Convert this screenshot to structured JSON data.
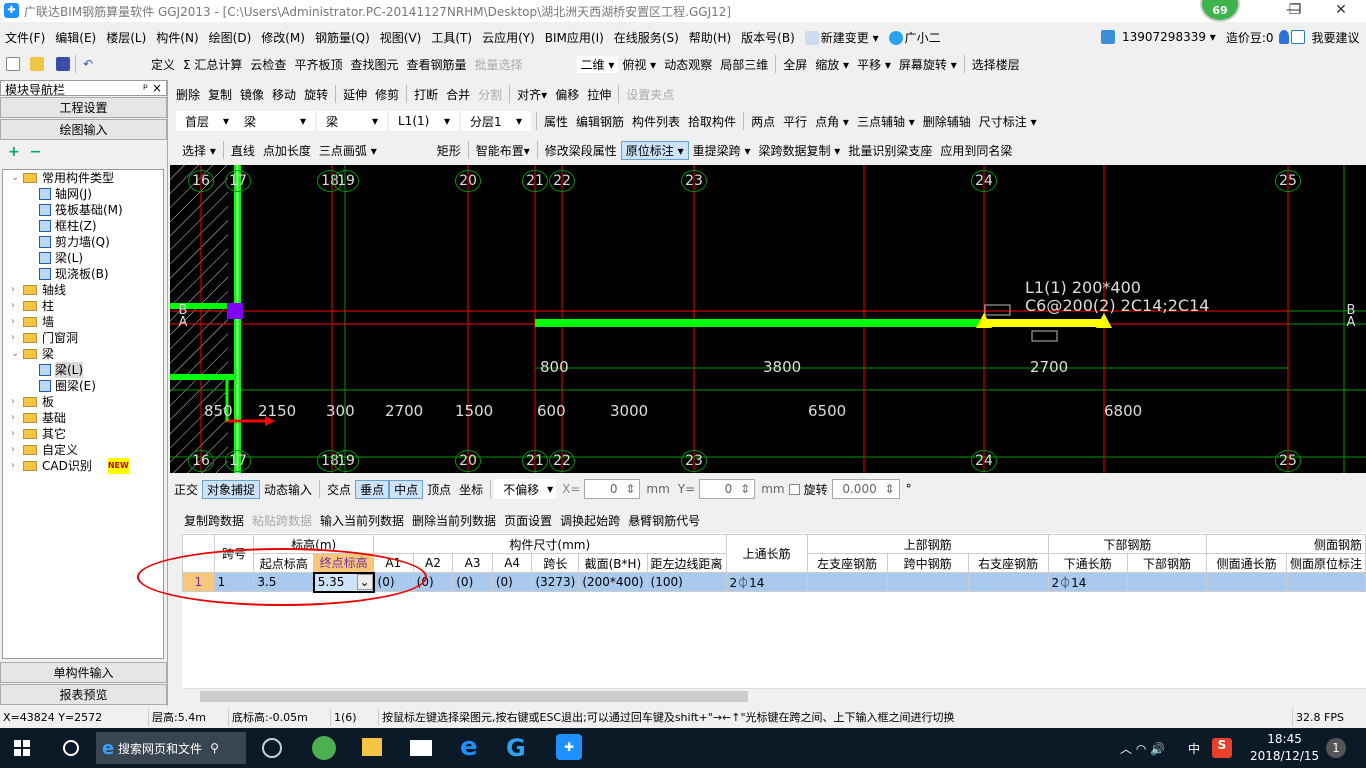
{
  "window": {
    "title": "广联达BIM钢筋算量软件 GGJ2013 - [C:\\Users\\Administrator.PC-20141127NRHM\\Desktop\\湖北洲天西湖桥安置区工程.GGJ12]",
    "badge": "69",
    "min": "—",
    "max": "❐",
    "close": "✕"
  },
  "menu": [
    "文件(F)",
    "编辑(E)",
    "楼层(L)",
    "构件(N)",
    "绘图(D)",
    "修改(M)",
    "钢筋量(Q)",
    "视图(V)",
    "工具(T)",
    "云应用(Y)",
    "BIM应用(I)",
    "在线服务(S)",
    "帮助(H)",
    "版本号(B)",
    "新建变更 ▾",
    "广小二"
  ],
  "account": {
    "phone": "13907298339 ▾",
    "beans": "造价豆:0",
    "suggest": "我要建议"
  },
  "toolbar1": {
    "items": [
      "定义",
      "Σ 汇总计算",
      "云检查",
      "平齐板顶",
      "查找图元",
      "查看钢筋量",
      "批量选择"
    ],
    "view": [
      "二维 ▾",
      "俯视 ▾",
      "动态观察",
      "局部三维",
      "全屏",
      "缩放 ▾",
      "平移 ▾",
      "屏幕旋转 ▾",
      "选择楼层"
    ]
  },
  "toolbar2": [
    "删除",
    "复制",
    "镜像",
    "移动",
    "旋转",
    "延伸",
    "修剪",
    "打断",
    "合并",
    "分割",
    "对齐▾",
    "偏移",
    "拉伸",
    "设置夹点"
  ],
  "toolbar3": {
    "combos": [
      "首层",
      "梁",
      "梁",
      "L1(1)",
      "分层1"
    ],
    "items": [
      "属性",
      "编辑钢筋",
      "构件列表",
      "拾取构件",
      "两点",
      "平行",
      "点角 ▾",
      "三点辅轴 ▾",
      "删除辅轴",
      "尺寸标注 ▾"
    ]
  },
  "toolbar4": [
    "选择 ▾",
    "直线",
    "点加长度",
    "三点画弧 ▾",
    "矩形",
    "智能布置▾",
    "修改梁段属性",
    "原位标注 ▾",
    "重提梁跨 ▾",
    "梁跨数据复制 ▾",
    "批量识别梁支座",
    "应用到同名梁"
  ],
  "nav": {
    "title": "模块导航栏",
    "pin": "ᵖ",
    "close": "×",
    "project_settings": "工程设置",
    "drawing_input": "绘图输入",
    "expand": "+",
    "collapse": "−",
    "single_input": "单构件输入",
    "report_preview": "报表预览"
  },
  "tree": [
    {
      "label": "常用构件类型",
      "level": 0,
      "type": "folder",
      "open": true
    },
    {
      "label": "轴网(J)",
      "level": 1,
      "type": "leaf"
    },
    {
      "label": "筏板基础(M)",
      "level": 1,
      "type": "leaf"
    },
    {
      "label": "框柱(Z)",
      "level": 1,
      "type": "leaf"
    },
    {
      "label": "剪力墙(Q)",
      "level": 1,
      "type": "leaf"
    },
    {
      "label": "梁(L)",
      "level": 1,
      "type": "leaf"
    },
    {
      "label": "现浇板(B)",
      "level": 1,
      "type": "leaf"
    },
    {
      "label": "轴线",
      "level": 0,
      "type": "folder"
    },
    {
      "label": "柱",
      "level": 0,
      "type": "folder"
    },
    {
      "label": "墙",
      "level": 0,
      "type": "folder"
    },
    {
      "label": "门窗洞",
      "level": 0,
      "type": "folder"
    },
    {
      "label": "梁",
      "level": 0,
      "type": "folder",
      "open": true
    },
    {
      "label": "梁(L)",
      "level": 1,
      "type": "leaf",
      "selected": true
    },
    {
      "label": "圈梁(E)",
      "level": 1,
      "type": "leaf"
    },
    {
      "label": "板",
      "level": 0,
      "type": "folder"
    },
    {
      "label": "基础",
      "level": 0,
      "type": "folder"
    },
    {
      "label": "其它",
      "level": 0,
      "type": "folder"
    },
    {
      "label": "自定义",
      "level": 0,
      "type": "folder"
    },
    {
      "label": "CAD识别",
      "level": 0,
      "type": "folder",
      "new": "NEW"
    }
  ],
  "canvas": {
    "axes": [
      "16",
      "17",
      "18",
      "19",
      "20",
      "21",
      "22",
      "23",
      "24",
      "25"
    ],
    "row_axes": [
      "B",
      "A"
    ],
    "dims_upper": [
      "800",
      "3800",
      "2700"
    ],
    "dims_lower": [
      "850",
      "2150",
      "300",
      "2700",
      "1500",
      "600",
      "3000",
      "6500",
      "6800"
    ],
    "beam_label1": "L1(1)  200*400",
    "beam_label2": "C6@200(2)  2C14;2C14"
  },
  "snapbar": {
    "items": [
      "正交",
      "对象捕捉",
      "动态输入",
      "交点",
      "垂点",
      "中点",
      "顶点",
      "坐标"
    ],
    "offset": "不偏移",
    "x_label": "X=",
    "x": "0",
    "unit": "mm",
    "y_label": "Y=",
    "y": "0",
    "rotate": "旋转",
    "angle": "0.000",
    "deg": "°"
  },
  "gridbar": [
    "复制跨数据",
    "粘贴跨数据",
    "输入当前列数据",
    "删除当前列数据",
    "页面设置",
    "调换起始跨",
    "悬臂钢筋代号"
  ],
  "table": {
    "h1": {
      "span": "跨号",
      "elev": "标高(m)",
      "size": "构件尺寸(mm)",
      "top_long": "上通长筋",
      "top": "上部钢筋",
      "bottom": "下部钢筋",
      "side": "侧面钢筋"
    },
    "h2": [
      "起点标高",
      "终点标高",
      "A1",
      "A2",
      "A3",
      "A4",
      "跨长",
      "截面(B*H)",
      "距左边线距离",
      "左支座钢筋",
      "跨中钢筋",
      "右支座钢筋",
      "下通长筋",
      "下部钢筋",
      "侧面通长筋",
      "侧面原位标注"
    ],
    "rows": [
      {
        "idx": "1",
        "span": "1",
        "start": "3.5",
        "end": "5.35",
        "a1": "(0)",
        "a2": "(0)",
        "a3": "(0)",
        "a4": "(0)",
        "len": "(3273)",
        "sect": "(200*400)",
        "dist": "(100)",
        "top_long": "2⏀14",
        "bottom_long": "2⏀14"
      }
    ]
  },
  "status": {
    "coords": "X=43824 Y=2572",
    "floor_h": "层高:5.4m",
    "base": "底标高:-0.05m",
    "span": "1(6)",
    "hint": "按鼠标左键选择梁图元,按右键或ESC退出;可以通过回车键及shift+\"→←↑\"光标键在跨之间、上下输入框之间进行切换",
    "fps": "32.8 FPS"
  },
  "taskbar": {
    "search": "搜索网页和文件",
    "time": "18:45",
    "date": "2018/12/15",
    "ime": "中",
    "notif": "1"
  },
  "colors": {
    "canvas_bg": "#000000",
    "axis_red": "#ff0000",
    "axis_green": "#00aa00",
    "beam_green": "#00ff00",
    "beam_selected": "#ffff00",
    "row_selected": "#a9c9ef",
    "annotation": "#e00000"
  }
}
